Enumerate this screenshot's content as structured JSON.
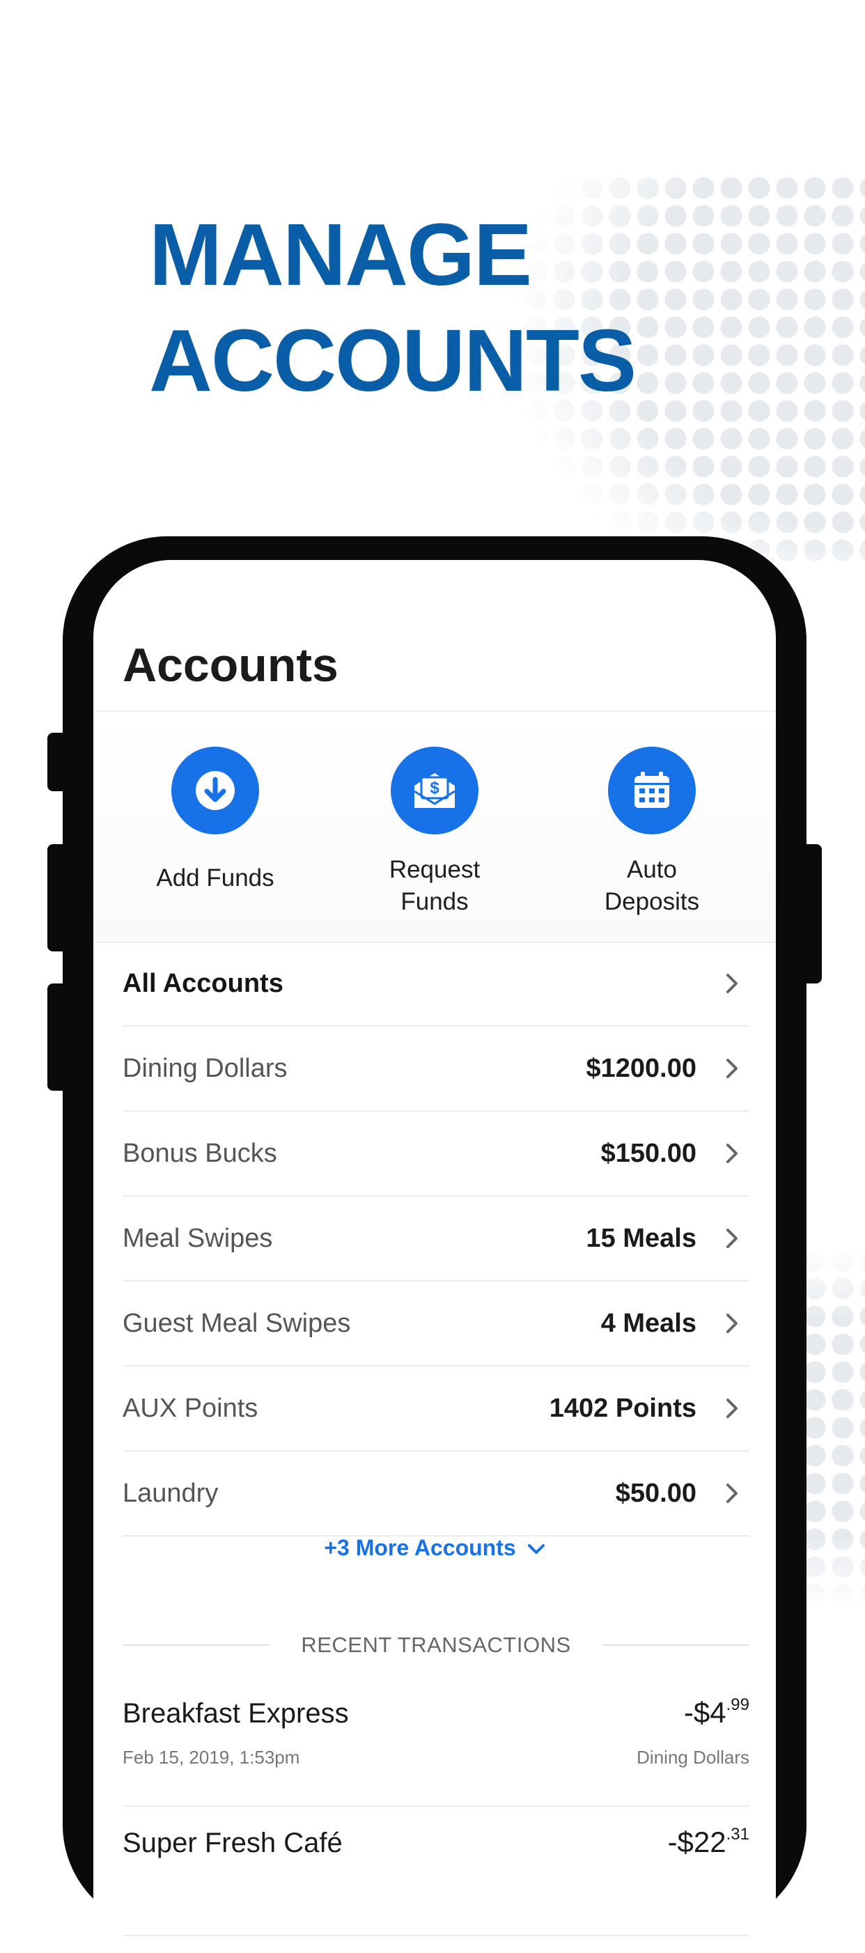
{
  "headline": {
    "line1": "MANAGE",
    "line2": "ACCOUNTS"
  },
  "screen": {
    "title": "Accounts",
    "actions": [
      {
        "label": "Add Funds",
        "icon": "download-arrow-icon"
      },
      {
        "label": "Request\nFunds",
        "icon": "money-envelope-icon"
      },
      {
        "label": "Auto\nDeposits",
        "icon": "calendar-icon"
      }
    ],
    "accounts": [
      {
        "name": "All Accounts",
        "value": ""
      },
      {
        "name": "Dining Dollars",
        "value": "$1200.00"
      },
      {
        "name": "Bonus Bucks",
        "value": "$150.00"
      },
      {
        "name": "Meal Swipes",
        "value": "15 Meals"
      },
      {
        "name": "Guest Meal Swipes",
        "value": "4 Meals"
      },
      {
        "name": "AUX Points",
        "value": "1402 Points"
      },
      {
        "name": "Laundry",
        "value": "$50.00"
      }
    ],
    "more_accounts": "+3 More Accounts",
    "recent_transactions_label": "RECENT TRANSACTIONS",
    "transactions": [
      {
        "merchant": "Breakfast Express",
        "date": "Feb 15, 2019, 1:53pm",
        "amount_main": "-$4",
        "amount_cents": ".99",
        "account": "Dining Dollars"
      },
      {
        "merchant": "Super Fresh Café",
        "date": "",
        "amount_main": "-$22",
        "amount_cents": ".31",
        "account": ""
      }
    ]
  },
  "colors": {
    "brand_blue": "#0a5ea8",
    "accent_blue": "#1672e6"
  }
}
